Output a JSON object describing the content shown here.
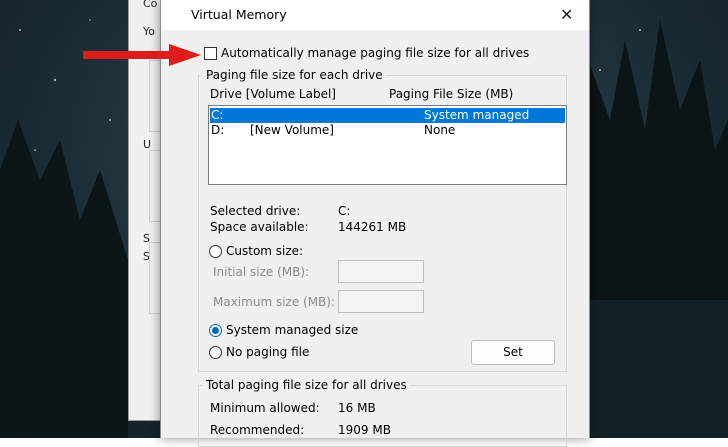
{
  "dialog": {
    "title": "Virtual Memory",
    "close_glyph": "✕",
    "auto_manage_label": "Automatically manage paging file size for all drives",
    "auto_manage_checked": false,
    "paging_group_title": "Paging file size for each drive",
    "columns": {
      "drive": "Drive  [Volume Label]",
      "size": "Paging File Size (MB)"
    },
    "drives": [
      {
        "drive": "C:",
        "label": "",
        "size": "System managed",
        "selected": true
      },
      {
        "drive": "D:",
        "label": "[New Volume]",
        "size": "None",
        "selected": false
      }
    ],
    "selected_drive_label": "Selected drive:",
    "selected_drive_value": "C:",
    "space_available_label": "Space available:",
    "space_available_value": "144261 MB",
    "custom_size_label": "Custom size:",
    "initial_size_label": "Initial size (MB):",
    "maximum_size_label": "Maximum size (MB):",
    "system_managed_label": "System managed size",
    "no_paging_label": "No paging file",
    "selected_option": "system_managed",
    "set_button": "Set",
    "total_group_title": "Total paging file size for all drives",
    "minimum_allowed_label": "Minimum allowed:",
    "minimum_allowed_value": "16 MB",
    "recommended_label": "Recommended:",
    "recommended_value": "1909 MB"
  },
  "back_window": {
    "fragments": [
      "Co",
      "Yo",
      "U",
      "S",
      "S"
    ]
  },
  "colors": {
    "selection": "#0078d7",
    "accent_radio": "#0067c0",
    "arrow": "#e01b1b",
    "dialog_bg": "#f0f0f0"
  }
}
